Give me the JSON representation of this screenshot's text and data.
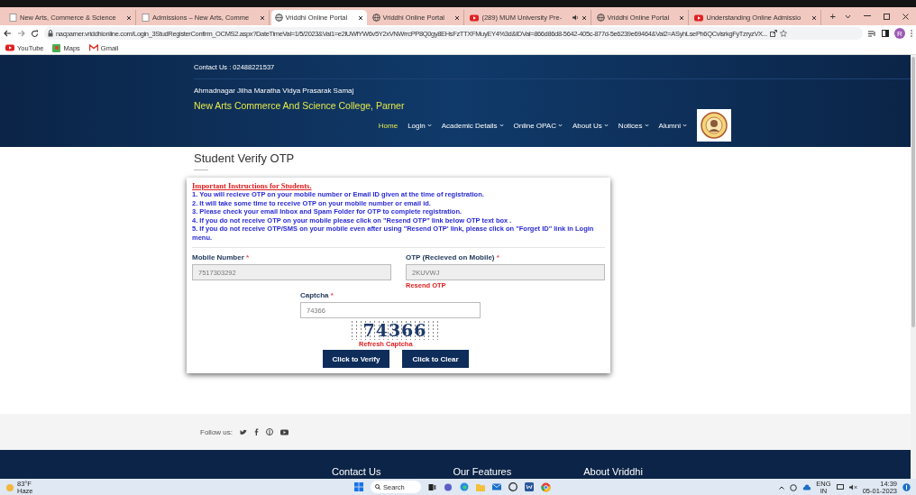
{
  "browser": {
    "tabs": [
      {
        "title": "New Arts, Commerce & Science",
        "selected": false,
        "kind": "doc",
        "audio": false
      },
      {
        "title": "Admissions – New Arts, Comme",
        "selected": false,
        "kind": "doc",
        "audio": false
      },
      {
        "title": "Vriddhi Online Portal",
        "selected": true,
        "kind": "globe",
        "audio": false
      },
      {
        "title": "Vriddhi Online Portal",
        "selected": false,
        "kind": "globe",
        "audio": false
      },
      {
        "title": "(289) MUM University Pre-",
        "selected": false,
        "kind": "video",
        "audio": true
      },
      {
        "title": "Vriddhi Online Portal",
        "selected": false,
        "kind": "globe",
        "audio": false
      },
      {
        "title": "Understanding Online Admissio",
        "selected": false,
        "kind": "video",
        "audio": false
      }
    ],
    "new_tab": "+",
    "url": "nacparner.vriddhionline.com/Login_3StudRegisterConfirm_OCMS2.aspx?DateTimeVal=1/5/2023&Val1=e2iUWfYW6v5Y2xVNWrrcPP8Q0gy8EHsFzTTXFMuyEY4%3d&IDVal=866d86d8-5642-405c-877d-5e6239e69464&Val2=ASyhLsePh6QCvlsrkgFyTzryzVX...",
    "profile": "R",
    "bookmarks": [
      {
        "label": "YouTube",
        "kind": "video"
      },
      {
        "label": "Maps",
        "kind": "maps"
      },
      {
        "label": "Gmail",
        "kind": "mail"
      }
    ]
  },
  "header": {
    "contact": "Contact Us : 02488221537",
    "society": "Ahmadnagar Jilha Maratha Vidya Prasarak Samaj",
    "college": "New Arts Commerce And Science College, Parner",
    "nav": [
      {
        "label": "Home",
        "selected": true,
        "dropdown": false
      },
      {
        "label": "Login",
        "selected": false,
        "dropdown": true
      },
      {
        "label": "Academic Details",
        "selected": false,
        "dropdown": true
      },
      {
        "label": "Online OPAC",
        "selected": false,
        "dropdown": true
      },
      {
        "label": "About Us",
        "selected": false,
        "dropdown": true
      },
      {
        "label": "Notices",
        "selected": false,
        "dropdown": true
      },
      {
        "label": "Alumni",
        "selected": false,
        "dropdown": true
      }
    ]
  },
  "page_title": "Student Verify OTP",
  "instructions": {
    "heading": "Important Instructions for Students.",
    "items": [
      "1. You will recieve OTP on your mobile number or Email ID given at the time of registration.",
      "2. It will take some time to receive OTP on your mobile number or email id.",
      "3. Please check your email Inbox and Spam Folder for OTP to complete registration.",
      "4. If you do not receive OTP on your mobile please click on \"Resend OTP\" link below OTP text box .",
      "5. If you do not receive OTP/SMS on your mobile even after using \"Resend OTP' link, please click on \"Forget ID\" link in Login menu."
    ]
  },
  "form": {
    "fields": [
      {
        "label": "Mobile Number",
        "mark": "*",
        "value": "7517303292",
        "disabled": true
      },
      {
        "label": "OTP (Recieved on Mobile)",
        "mark": "*",
        "value": "2KUVWJ",
        "disabled": true,
        "link": "Resend OTP"
      }
    ],
    "captcha": {
      "label": "Captcha",
      "mark": "*",
      "value": "74366",
      "disabled": false,
      "image_text": "74366",
      "refresh": "Refresh Captcha"
    },
    "buttons": [
      "Click to Verify",
      "Click to Clear"
    ]
  },
  "follow": {
    "label": "Follow us:"
  },
  "footer": {
    "headings": [
      "Contact Us",
      "Our Features",
      "About Vriddhi"
    ]
  },
  "taskbar": {
    "temperature": "83°F",
    "weather": "Haze",
    "search": "Search",
    "language": "ENG",
    "region": "IN",
    "time": "14:39",
    "date": "05-01-2023"
  }
}
